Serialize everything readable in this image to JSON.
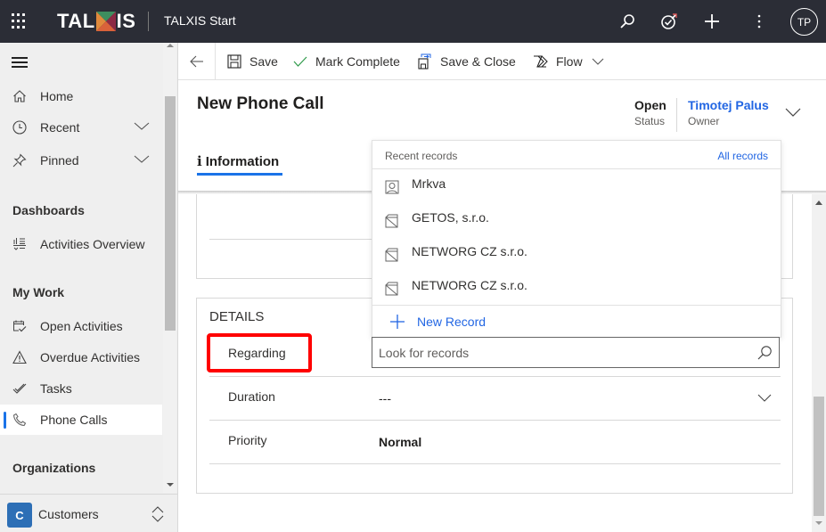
{
  "topbar": {
    "logo_text_left": "TAL",
    "logo_text_right": "IS",
    "app_title": "TALXIS Start",
    "icons": [
      "search-icon",
      "assistant-icon",
      "new-icon",
      "more-icon"
    ],
    "avatar_initials": "TP",
    "logo_colors": [
      "#3e8e5f",
      "#e08a3c",
      "#8c2a45",
      "#d9623a"
    ]
  },
  "sidebar": {
    "top_items": [
      {
        "label": "Home",
        "icon": "home-icon"
      },
      {
        "label": "Recent",
        "icon": "clock-icon",
        "expandable": true
      },
      {
        "label": "Pinned",
        "icon": "pin-icon",
        "expandable": true
      }
    ],
    "groups": [
      {
        "title": "Dashboards",
        "items": [
          {
            "label": "Activities Overview",
            "icon": "dashboard-icon"
          }
        ]
      },
      {
        "title": "My Work",
        "items": [
          {
            "label": "Open Activities",
            "icon": "calendar-check-icon"
          },
          {
            "label": "Overdue Activities",
            "icon": "warning-icon"
          },
          {
            "label": "Tasks",
            "icon": "task-icon"
          },
          {
            "label": "Phone Calls",
            "icon": "phone-icon",
            "active": true
          }
        ]
      },
      {
        "title": "Organizations",
        "items": []
      }
    ],
    "area": {
      "badge": "C",
      "label": "Customers",
      "badge_color": "#2d6fb6"
    }
  },
  "commandbar": {
    "back": "back",
    "save": "Save",
    "mark_complete": "Mark Complete",
    "save_close": "Save & Close",
    "flow": "Flow"
  },
  "header": {
    "title": "New Phone Call",
    "status_value": "Open",
    "status_label": "Status",
    "owner_value": "Timotej Palus",
    "owner_label": "Owner",
    "tab": {
      "icon": "i",
      "label": "Information"
    },
    "accent": "#1a73e8"
  },
  "details": {
    "section_title": "DETAILS",
    "fields": [
      {
        "label": "Regarding",
        "value": ""
      },
      {
        "label": "Duration",
        "value": "---"
      },
      {
        "label": "Priority",
        "value": "Normal"
      }
    ]
  },
  "lookup": {
    "header": "Recent records",
    "all_records": "All records",
    "records": [
      {
        "name": "Mrkva",
        "icon": "contact-icon"
      },
      {
        "name": "GETOS, s.r.o.",
        "icon": "account-icon"
      },
      {
        "name": "NETWORG CZ s.r.o.",
        "icon": "account-icon"
      },
      {
        "name": "NETWORG CZ s.r.o.",
        "icon": "account-icon"
      }
    ],
    "new_record": "New Record",
    "placeholder": "Look for records",
    "value": ""
  },
  "annotation": {
    "highlight_color": "#ff0000",
    "target": "Regarding"
  }
}
